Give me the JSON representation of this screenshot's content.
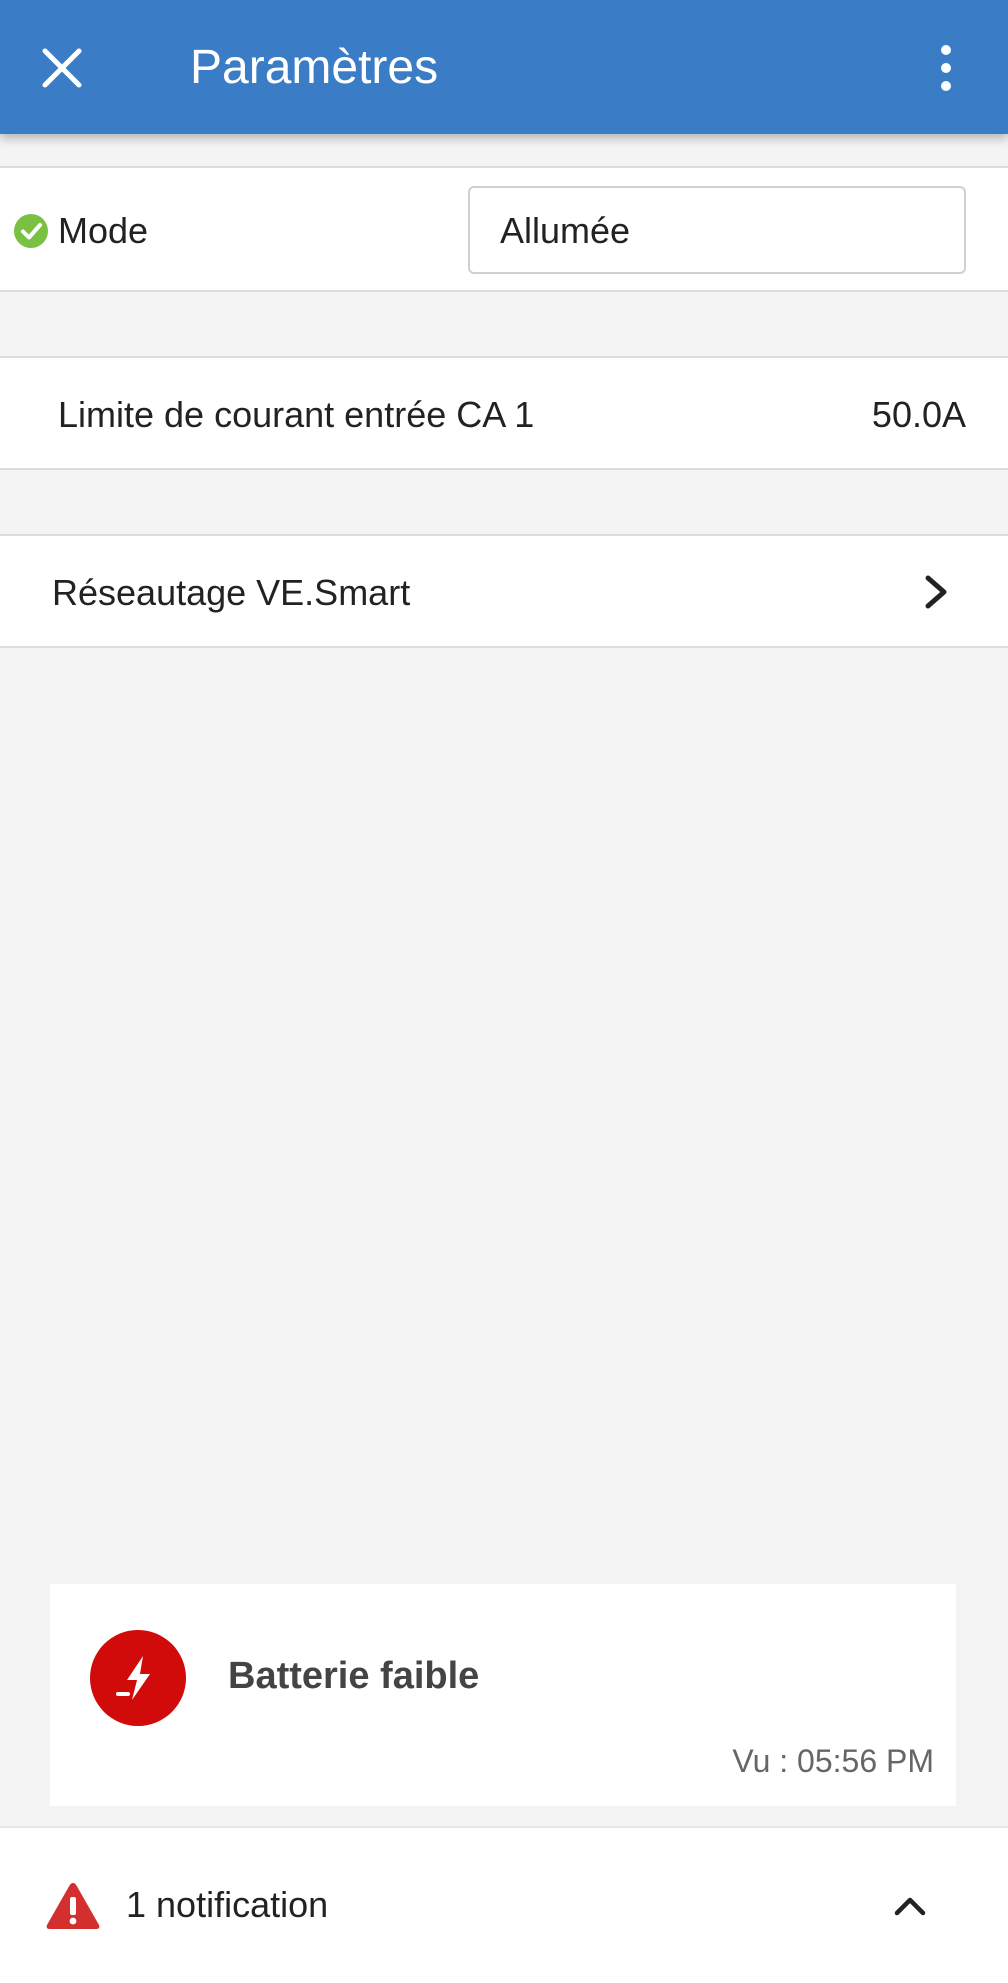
{
  "app_bar": {
    "title": "Paramètres",
    "close_icon": "close-icon",
    "menu_icon": "more-vertical-icon",
    "background_color": "#3a7dc6"
  },
  "settings": {
    "mode": {
      "label": "Mode",
      "value": "Allumée",
      "status_icon": "check-circle-icon",
      "status_color": "#7ac143"
    },
    "input_current_limit": {
      "label": "Limite de courant entrée CA 1",
      "value": "50.0A"
    },
    "networking": {
      "label": "Réseautage VE.Smart",
      "chevron_icon": "chevron-right-icon"
    }
  },
  "notification_card": {
    "title": "Batterie faible",
    "seen_time": "Vu : 05:56 PM",
    "icon": "low-battery-icon",
    "icon_color": "#d10a0a"
  },
  "bottom_bar": {
    "count_text": "1 notification",
    "warning_icon": "warning-triangle-icon",
    "expand_icon": "chevron-up-icon"
  }
}
